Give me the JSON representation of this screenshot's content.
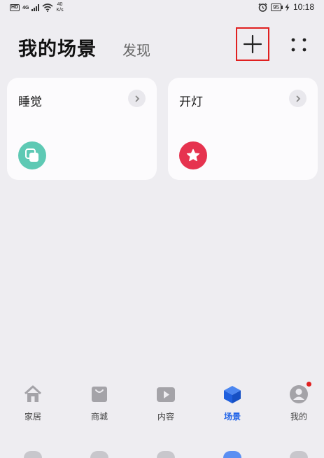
{
  "status_bar": {
    "hd": "HD",
    "network": "4G",
    "speed_value": "40",
    "speed_unit": "K/s",
    "battery": "95",
    "time": "10:18"
  },
  "header": {
    "title": "我的场景",
    "discover_tab": "发现"
  },
  "scenes": [
    {
      "label": "睡觉",
      "icon": "overlapping-squares-icon",
      "icon_color": "#5ec9b4"
    },
    {
      "label": "开灯",
      "icon": "star-icon",
      "icon_color": "#e6334f"
    }
  ],
  "bottom_nav": [
    {
      "label": "家居",
      "icon": "home-icon",
      "active": false
    },
    {
      "label": "商城",
      "icon": "shopping-bag-icon",
      "active": false
    },
    {
      "label": "内容",
      "icon": "play-icon",
      "active": false
    },
    {
      "label": "场景",
      "icon": "cube-icon",
      "active": true
    },
    {
      "label": "我的",
      "icon": "profile-icon",
      "active": false,
      "badge": true
    }
  ],
  "colors": {
    "background": "#eeedf1",
    "card": "#fcfbfd",
    "accent": "#2063e8",
    "highlight_box": "#e02020"
  }
}
